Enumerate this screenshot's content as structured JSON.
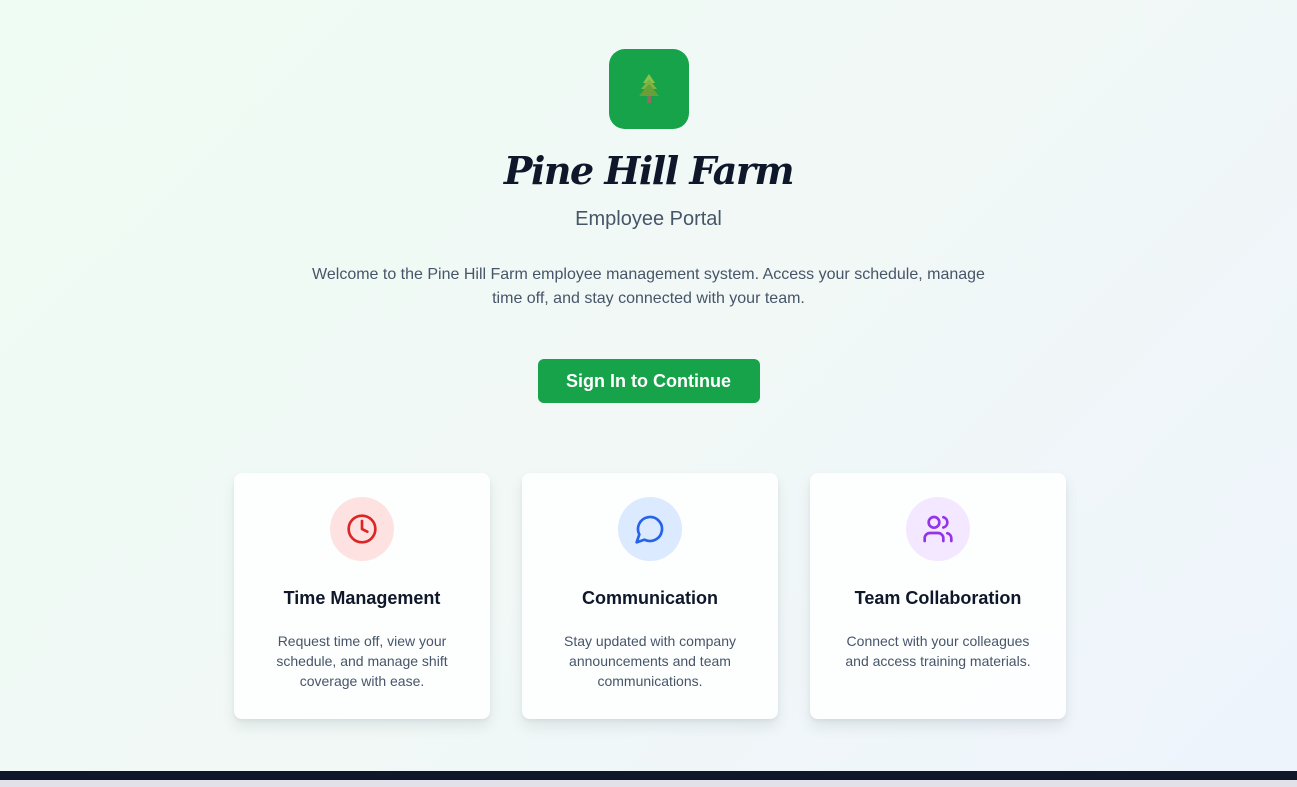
{
  "brand": {
    "name": "Pine Hill Farm",
    "logo_icon": "pine-tree-icon",
    "accent_color": "#16a34a"
  },
  "hero": {
    "subtitle": "Employee Portal",
    "welcome": "Welcome to the Pine Hill Farm employee management system. Access your schedule, manage time off, and stay connected with your team.",
    "signin_label": "Sign In to Continue"
  },
  "features": [
    {
      "icon": "clock-icon",
      "icon_color": "#dc2626",
      "icon_bg": "#fee2e2",
      "title": "Time Management",
      "description": "Request time off, view your schedule, and manage shift coverage with ease."
    },
    {
      "icon": "message-circle-icon",
      "icon_color": "#2563eb",
      "icon_bg": "#dbeafe",
      "title": "Communication",
      "description": "Stay updated with company announcements and team communications."
    },
    {
      "icon": "users-icon",
      "icon_color": "#9333ea",
      "icon_bg": "#f3e8ff",
      "title": "Team Collaboration",
      "description": "Connect with your colleagues and access training materials."
    }
  ]
}
